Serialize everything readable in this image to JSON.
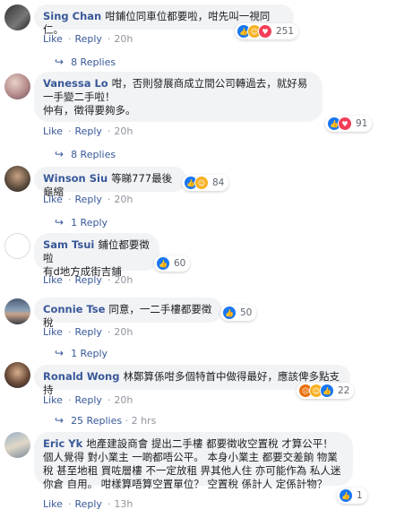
{
  "comments": [
    {
      "author": "Sing Chan",
      "text": "咁鋪位同車位都要啦，咁先叫一視同仁。",
      "like": "Like",
      "reply": "Reply",
      "time": "20h",
      "reactions": [
        "like",
        "haha",
        "love"
      ],
      "reaction_count": "251",
      "replies_label": "8 Replies",
      "replies_time": ""
    },
    {
      "author": "Vanessa Lo",
      "text": "咁，否則發展商成立間公司轉過去，就好易一手變二手啦！\n仲有，徵得要夠多。",
      "like": "Like",
      "reply": "Reply",
      "time": "20h",
      "reactions": [
        "like",
        "love"
      ],
      "reaction_count": "91",
      "replies_label": "8 Replies",
      "replies_time": ""
    },
    {
      "author": "Winson Siu",
      "text": "等睇777最後龜縮",
      "like": "Like",
      "reply": "Reply",
      "time": "20h",
      "reactions": [
        "like",
        "haha"
      ],
      "reaction_count": "84",
      "replies_label": "1 Reply",
      "replies_time": ""
    },
    {
      "author": "Sam Tsui",
      "text": "鋪位都要徵啦\n有d地方成街吉鋪",
      "like": "Like",
      "reply": "Reply",
      "time": "20h",
      "reactions": [
        "like"
      ],
      "reaction_count": "60",
      "replies_label": "",
      "replies_time": ""
    },
    {
      "author": "Connie Tse",
      "text": "同意，一二手樓都要徵稅",
      "like": "Like",
      "reply": "Reply",
      "time": "20h",
      "reactions": [
        "like"
      ],
      "reaction_count": "50",
      "replies_label": "1 Reply",
      "replies_time": ""
    },
    {
      "author": "Ronald Wong",
      "text": "林鄭算係咁多個特首中做得最好，應該俾多點支持",
      "like": "Like",
      "reply": "Reply",
      "time": "20h",
      "reactions": [
        "angry",
        "haha",
        "like"
      ],
      "reaction_count": "22",
      "replies_label": "25 Replies",
      "replies_time": "2 hrs"
    },
    {
      "author": "Eric Yk",
      "text": "地產建設商會 提出二手樓 都要徵收空置稅 才算公平！ 個人覺得 對小業主 一啲都唔公平。 本身小業主 都要交差餉 物業稅 甚至地租 買咗層樓 不一定放租 畀其他人住 亦可能作為 私人迷你倉 自用。 咁樣算唔算空置單位？ 空置稅 係計人 定係計物？",
      "like": "Like",
      "reply": "Reply",
      "time": "13h",
      "reactions": [
        "like"
      ],
      "reaction_count": "1",
      "replies_label": "",
      "replies_time": ""
    }
  ],
  "icons": {
    "like": "thumbs-up-icon",
    "haha": "laughing-face-icon",
    "love": "heart-icon",
    "angry": "angry-face-icon",
    "reply_arrow": "reply-arrow-icon"
  },
  "colors": {
    "author": "#385898",
    "bubble": "#f2f3f5",
    "like": "#1877f2",
    "love": "#f33e58",
    "haha": "#f7b125",
    "angry": "#e9710f"
  }
}
